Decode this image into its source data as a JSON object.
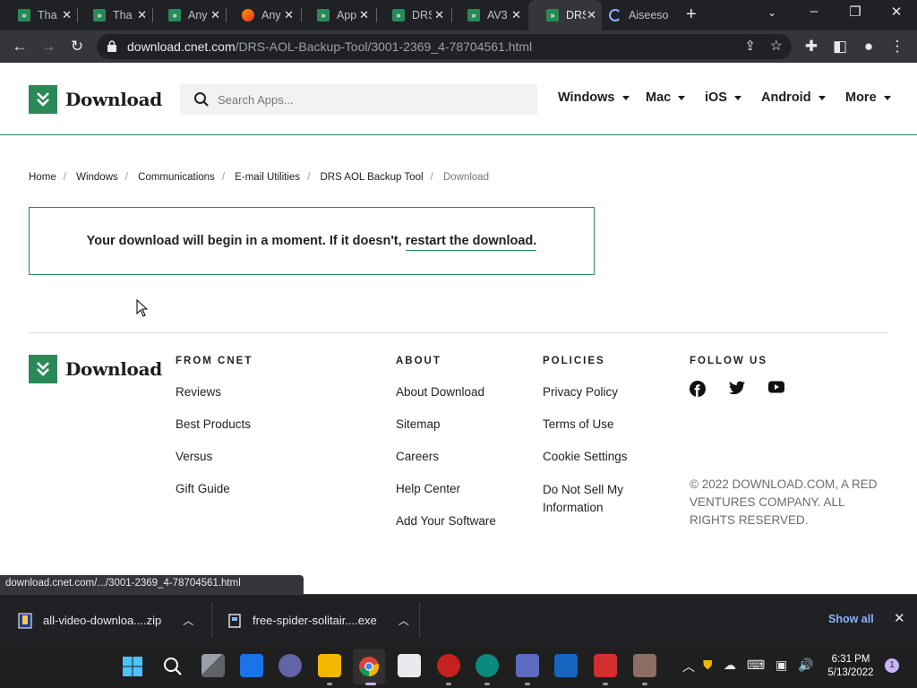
{
  "browser": {
    "tabs": [
      {
        "title": "Tha",
        "icon": "download-favicon-icon"
      },
      {
        "title": "Tha",
        "icon": "download-favicon-icon"
      },
      {
        "title": "Any",
        "icon": "download-favicon-icon"
      },
      {
        "title": "Any",
        "icon": "firefox-favicon-icon"
      },
      {
        "title": "App",
        "icon": "download-favicon-icon"
      },
      {
        "title": "DRS",
        "icon": "download-favicon-icon"
      },
      {
        "title": "AV3",
        "icon": "download-favicon-icon"
      },
      {
        "title": "DRS",
        "icon": "download-favicon-icon",
        "active": true
      },
      {
        "title": "Aiseeso",
        "icon": "loading-spinner-icon"
      }
    ],
    "url_domain": "download.cnet.com",
    "url_path": "/DRS-AOL-Backup-Tool/3001-2369_4-78704561.html",
    "status_url": "download.cnet.com/.../3001-2369_4-78704561.html"
  },
  "site": {
    "logo_text": "Download",
    "search_placeholder": "Search Apps...",
    "nav": [
      "Windows",
      "Mac",
      "iOS",
      "Android",
      "More"
    ]
  },
  "breadcrumb": [
    "Home",
    "Windows",
    "Communications",
    "E-mail Utilities",
    "DRS AOL Backup Tool",
    "Download"
  ],
  "notice": {
    "text": "Your download will begin in a moment. If it doesn't, ",
    "link": "restart the download."
  },
  "footer": {
    "logo_text": "Download",
    "columns": [
      {
        "heading": "FROM CNET",
        "links": [
          "Reviews",
          "Best Products",
          "Versus",
          "Gift Guide"
        ]
      },
      {
        "heading": "ABOUT",
        "links": [
          "About Download",
          "Sitemap",
          "Careers",
          "Help Center",
          "Add Your Software"
        ]
      },
      {
        "heading": "POLICIES",
        "links": [
          "Privacy Policy",
          "Terms of Use",
          "Cookie Settings",
          "Do Not Sell My Information"
        ]
      },
      {
        "heading": "FOLLOW US",
        "social": [
          "facebook-icon",
          "twitter-icon",
          "youtube-icon"
        ]
      }
    ],
    "copyright": "© 2022 DOWNLOAD.COM, A RED VENTURES COMPANY. ALL RIGHTS RESERVED."
  },
  "downloads": {
    "items": [
      "all-video-downloa....zip",
      "free-spider-solitair....exe"
    ],
    "show_all": "Show all"
  },
  "taskbar": {
    "time": "6:31 PM",
    "date": "5/13/2022",
    "notifications": "1"
  },
  "colors": {
    "brand_green": "#2a8a57",
    "chrome_dark": "#202124",
    "chrome_toolbar": "#35363a",
    "link_blue": "#8ab4f8"
  }
}
